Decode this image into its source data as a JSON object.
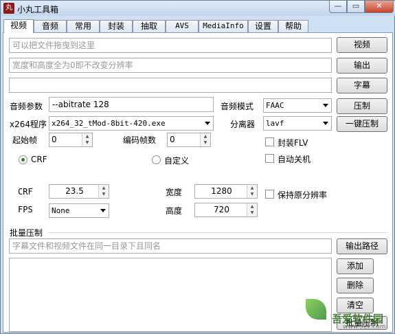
{
  "window": {
    "title": "小丸工具箱",
    "icon_text": "丸",
    "min": "—",
    "max": "▭",
    "close": "✕"
  },
  "tabs": [
    "视频",
    "音频",
    "常用",
    "封装",
    "抽取",
    "AVS",
    "MediaInfo",
    "设置",
    "帮助"
  ],
  "video": {
    "file_placeholder": "可以把文件拖曳到这里",
    "resolution_placeholder": "宽度和高度全为0即不改变分辨率",
    "subtitle_value": "",
    "btn_video": "视频",
    "btn_output": "输出",
    "btn_subtitle": "字幕",
    "audio_params_label": "音频参数",
    "audio_params_value": "--abitrate 128",
    "audio_mode_label": "音频模式",
    "audio_mode_value": "FAAC",
    "btn_compress": "压制",
    "x264_label": "x264程序",
    "x264_value": "x264_32_tMod-8bit-420.exe",
    "splitter_label": "分离器",
    "splitter_value": "lavf",
    "btn_one_click": "一键压制",
    "start_frame_label": "起始帧",
    "start_frame_value": "0",
    "encode_frames_label": "编码帧数",
    "encode_frames_value": "0",
    "flv_label": "封装FLV",
    "shutdown_label": "自动关机",
    "crf_radio_label": "CRF",
    "custom_radio_label": "自定义",
    "crf_label": "CRF",
    "crf_value": "23.5",
    "width_label": "宽度",
    "width_value": "1280",
    "keep_res_label": "保持原分辨率",
    "fps_label": "FPS",
    "fps_value": "None",
    "height_label": "高度",
    "height_value": "720"
  },
  "batch": {
    "title": "批量压制",
    "hint_placeholder": "字幕文件和视频文件在同一目录下且同名",
    "btn_output_path": "输出路径",
    "btn_add": "添加",
    "btn_delete": "删除",
    "btn_clear": "清空",
    "btn_batch": "批量压制"
  },
  "watermark": {
    "text": "吾爱软件园",
    "url": "www.52z.com"
  }
}
